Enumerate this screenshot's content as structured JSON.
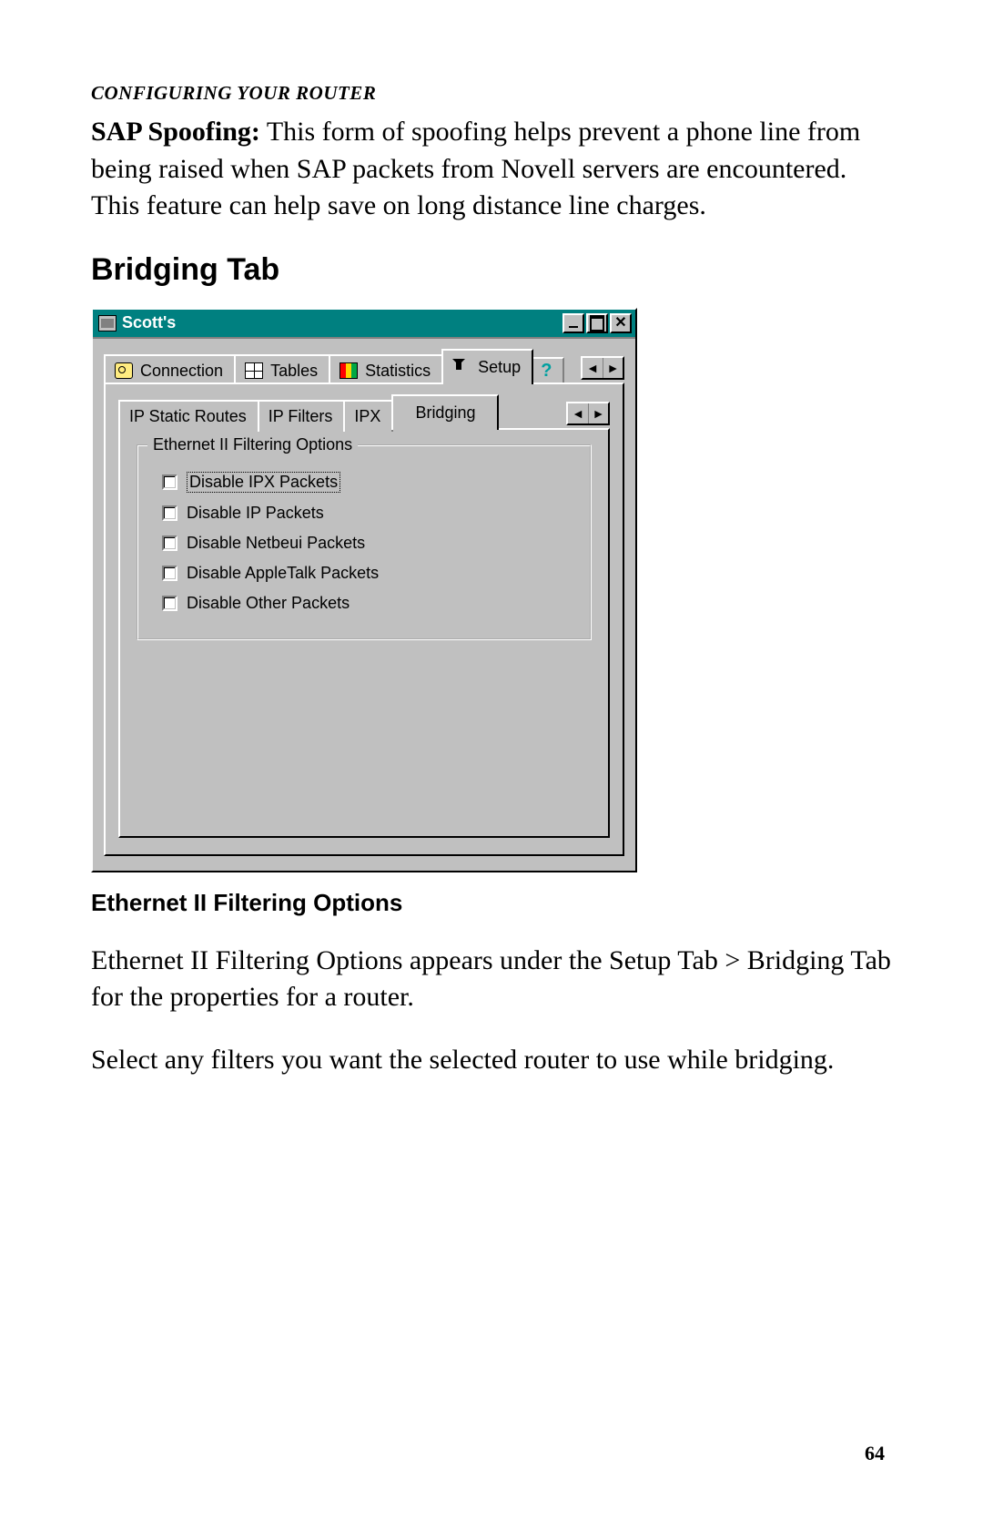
{
  "runningHead": "CONFIGURING YOUR ROUTER",
  "para1_bold": "SAP Spoofing:",
  "para1_rest": " This form of spoofing helps prevent a phone line from being raised when SAP packets from Novell servers are encountered. This feature can help save on long distance line charges.",
  "heading1": "Bridging Tab",
  "heading2": "Ethernet II Filtering Options",
  "para2": "Ethernet II Filtering Options appears under the Setup Tab > Bridging Tab for the properties for a router.",
  "para3": "Select any filters you want the selected router to use while bridging.",
  "pageNumber": "64",
  "window": {
    "title": "Scott's",
    "mainTabs": {
      "connection": "Connection",
      "tables": "Tables",
      "statistics": "Statistics",
      "setup": "Setup"
    },
    "subTabs": {
      "ipStaticRoutes": "IP Static Routes",
      "ipFilters": "IP Filters",
      "ipx": "IPX",
      "bridging": "Bridging"
    },
    "group": {
      "legend": "Ethernet II Filtering Options",
      "items": [
        "Disable IPX Packets",
        "Disable IP Packets",
        "Disable Netbeui Packets",
        "Disable AppleTalk Packets",
        "Disable Other Packets"
      ]
    }
  }
}
